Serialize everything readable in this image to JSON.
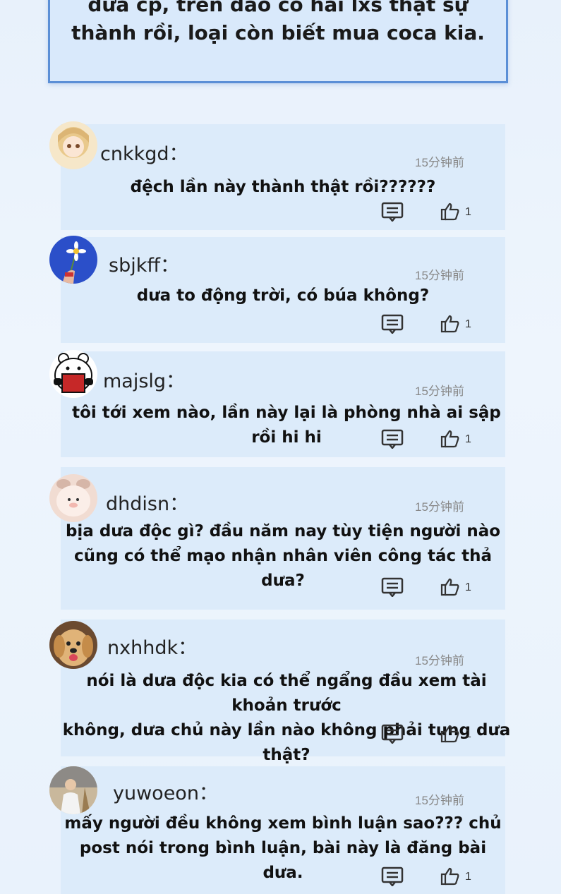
{
  "top_box": {
    "line1": "dưa cp, trên đảo có hai lxs thật sự",
    "line2": "thành rồi, loại còn biết mua coca kia."
  },
  "comments": [
    {
      "username": "cnkkgd：",
      "time": "15分钟前",
      "text": [
        "đệch lần này thành thật rồi??????"
      ],
      "likes": "1",
      "avatar_icon": "anime-girl-avatar"
    },
    {
      "username": "sbjkff：",
      "time": "15分钟前",
      "text": [
        "dưa to động trời, có búa không?"
      ],
      "likes": "1",
      "avatar_icon": "flower-avatar"
    },
    {
      "username": "majslg：",
      "time": "15分钟前",
      "text": [
        "tôi tới xem nào, lần này lại là phòng nhà ai sập rồi hi hi"
      ],
      "likes": "1",
      "avatar_icon": "bear-avatar"
    },
    {
      "username": "dhdisn：",
      "time": "15分钟前",
      "text": [
        "bịa dưa độc gì? đầu năm nay tùy tiện người nào",
        "cũng có thể mạo nhận nhân viên công tác thả dưa?"
      ],
      "likes": "1",
      "avatar_icon": "pig-avatar"
    },
    {
      "username": "nxhhdk：",
      "time": "15分钟前",
      "text": [
        "nói là dưa độc kia có thể ngẩng đầu xem tài khoản trước",
        "không, dưa chủ này lần nào không phải tung dưa thật?"
      ],
      "likes": "1",
      "avatar_icon": "dog-avatar"
    },
    {
      "username": "yuwoeon：",
      "time": "15分钟前",
      "text": [
        "mấy người đều không xem bình luận sao??? chủ",
        "post nói trong bình luận, bài này là đăng bài dưa."
      ],
      "likes": "1",
      "avatar_icon": "person-avatar"
    }
  ],
  "colors": {
    "card": "#dcebfa",
    "border": "#5b8fd6",
    "time": "#888888"
  }
}
